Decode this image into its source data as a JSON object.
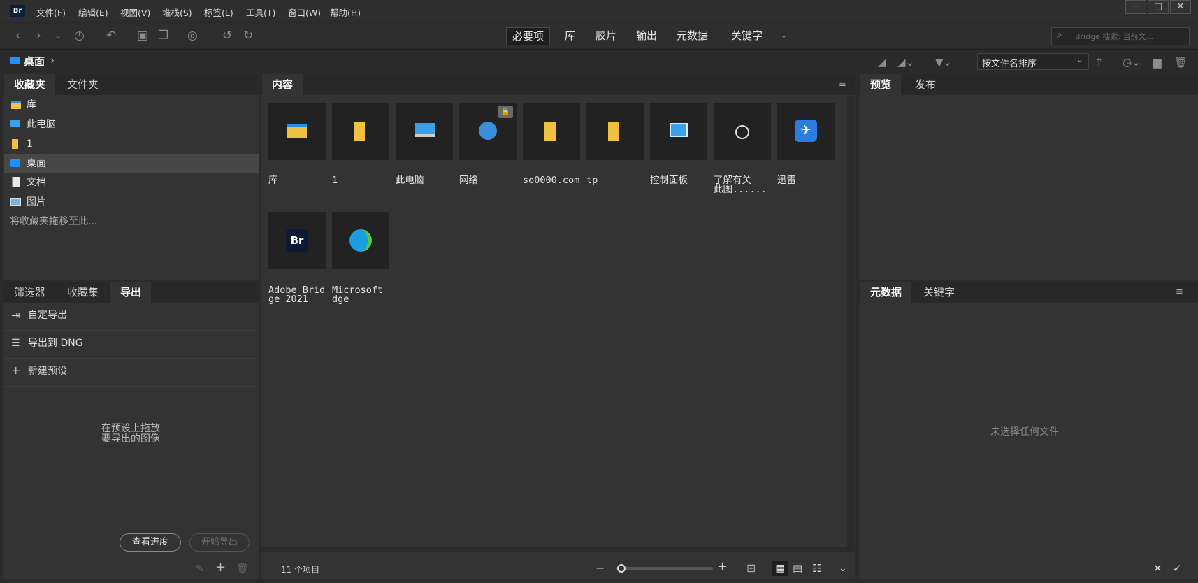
{
  "app": {
    "logo": "Br"
  },
  "menu": [
    "文件(F)",
    "编辑(E)",
    "视图(V)",
    "堆栈(S)",
    "标签(L)",
    "工具(T)",
    "窗口(W)",
    "帮助(H)"
  ],
  "window_controls": {
    "minimize": "─",
    "maximize": "□",
    "close": "✕"
  },
  "workspaces": [
    "必要项",
    "库",
    "胶片",
    "输出",
    "元数据",
    "关键字"
  ],
  "search": {
    "placeholder": "Bridge 搜索: 当前文..."
  },
  "breadcrumb": {
    "current": "桌面",
    "separator": "›"
  },
  "sort": {
    "value": "按文件名排序",
    "arrow": "⌄"
  },
  "left_top": {
    "tabs": [
      "收藏夹",
      "文件夹"
    ],
    "items": [
      {
        "label": "库",
        "icon": "library-folder-icon"
      },
      {
        "label": "此电脑",
        "icon": "computer-icon"
      },
      {
        "label": "1",
        "icon": "folder-icon"
      },
      {
        "label": "桌面",
        "icon": "desktop-icon"
      },
      {
        "label": "文档",
        "icon": "document-icon"
      },
      {
        "label": "图片",
        "icon": "pictures-icon"
      }
    ],
    "hint": "将收藏夹拖移至此..."
  },
  "left_bottom": {
    "tabs": [
      "筛选器",
      "收藏集",
      "导出"
    ],
    "actions": [
      "自定导出",
      "导出到 DNG",
      "新建预设"
    ],
    "hint_line1": "在预设上拖放",
    "hint_line2": "要导出的图像",
    "view_progress": "查看进度",
    "start_export": "开始导出"
  },
  "content": {
    "tab": "内容",
    "items": [
      {
        "label": "库",
        "icon": "library-folder-icon"
      },
      {
        "label": "1",
        "icon": "folder-icon"
      },
      {
        "label": "此电脑",
        "icon": "computer-icon"
      },
      {
        "label": "网络",
        "icon": "network-icon",
        "locked": true
      },
      {
        "label": "so0000.com",
        "icon": "folder-icon"
      },
      {
        "label": "tp",
        "icon": "folder-icon"
      },
      {
        "label": "控制面板",
        "icon": "control-panel-icon"
      },
      {
        "label": "了解有关\n此图......",
        "icon": "info-shortcut-icon"
      },
      {
        "label": "迅雷",
        "icon": "xunlei-app-icon"
      },
      {
        "label": "Adobe Brid\nge 2021",
        "icon": "bridge-app-icon"
      },
      {
        "label": "Microsoft\ndge",
        "icon": "edge-app-icon"
      }
    ],
    "status": "11 个项目"
  },
  "right_top": {
    "tabs": [
      "预览",
      "发布"
    ]
  },
  "right_bottom": {
    "tabs": [
      "元数据",
      "关键字"
    ],
    "empty": "未选择任何文件"
  },
  "colors": {
    "accent_blue": "#1e90ff",
    "folder_yellow": "#f0c040",
    "panel_bg": "#333333",
    "bg": "#2b2b2b"
  }
}
